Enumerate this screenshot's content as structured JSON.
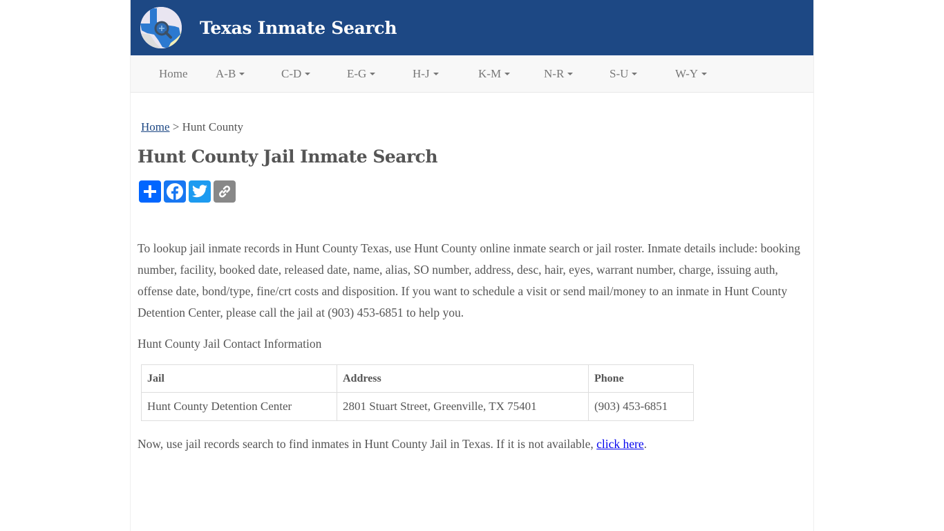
{
  "header": {
    "site_title": "Texas Inmate Search",
    "logo_icon": "texas-map-magnifier-icon",
    "brand_color": "#1d4884"
  },
  "nav": {
    "items": [
      {
        "label": "Home",
        "dropdown": false
      },
      {
        "label": "A-B",
        "dropdown": true
      },
      {
        "label": "C-D",
        "dropdown": true
      },
      {
        "label": "E-G",
        "dropdown": true
      },
      {
        "label": "H-J",
        "dropdown": true
      },
      {
        "label": "K-M",
        "dropdown": true
      },
      {
        "label": "N-R",
        "dropdown": true
      },
      {
        "label": "S-U",
        "dropdown": true
      },
      {
        "label": "W-Y",
        "dropdown": true
      }
    ]
  },
  "breadcrumb": {
    "home_label": "Home",
    "separator": ">",
    "current": "Hunt County"
  },
  "page": {
    "title": "Hunt County Jail Inmate Search",
    "share_buttons": [
      {
        "name": "share",
        "icon": "plus-icon",
        "color": "#0166ff"
      },
      {
        "name": "facebook",
        "icon": "facebook-icon",
        "color": "#1877f2"
      },
      {
        "name": "twitter",
        "icon": "twitter-icon",
        "color": "#1d9bf0"
      },
      {
        "name": "copy-link",
        "icon": "link-icon",
        "color": "#888888"
      }
    ],
    "intro": "To lookup jail inmate records in Hunt County Texas, use Hunt County online inmate search or jail roster. Inmate details include: booking number, facility, booked date, released date, name, alias, SO number, address, desc, hair, eyes, warrant number, charge, issuing auth, offense date, bond/type, fine/crt costs and disposition. If you want to schedule a visit or send mail/money to an inmate in Hunt County Detention Center, please call the jail at (903) 453-6851 to help you.",
    "contact_heading": "Hunt County Jail Contact Information",
    "table": {
      "headers": [
        "Jail",
        "Address",
        "Phone"
      ],
      "rows": [
        [
          "Hunt County Detention Center",
          "2801 Stuart Street, Greenville, TX 75401",
          "(903) 453-6851"
        ]
      ]
    },
    "footer_text": "Now, use jail records search to find inmates in Hunt County Jail in Texas. If it is not available, ",
    "footer_link": "click here",
    "footer_end": "."
  }
}
